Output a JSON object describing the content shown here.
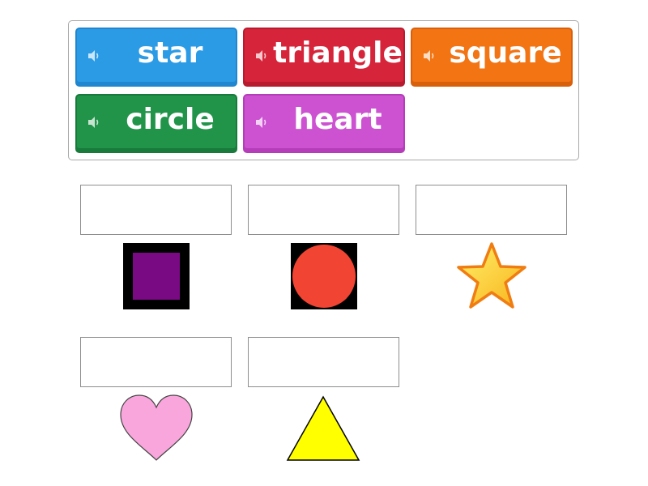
{
  "word_bank": {
    "tiles": [
      {
        "label": "star",
        "color": "#2c9be6",
        "shade": "#1f86cf",
        "icon": "speaker-icon"
      },
      {
        "label": "triangle",
        "color": "#d6243a",
        "shade": "#b91b2e",
        "icon": "speaker-icon"
      },
      {
        "label": "square",
        "color": "#f27413",
        "shade": "#d9600a",
        "icon": "speaker-icon"
      },
      {
        "label": "circle",
        "color": "#21944a",
        "shade": "#187a3b",
        "icon": "speaker-icon"
      },
      {
        "label": "heart",
        "color": "#cc52d1",
        "shade": "#b53db9",
        "icon": "speaker-icon"
      }
    ]
  },
  "targets": [
    {
      "shape": "square",
      "fill": "#7a0a84",
      "background": "#000000"
    },
    {
      "shape": "circle",
      "fill": "#f24432",
      "background": "#000000"
    },
    {
      "shape": "star",
      "fill": "#ffd23c",
      "stroke": "#f07d12"
    },
    {
      "shape": "heart",
      "fill": "#f9a6dc",
      "stroke": "#444444"
    },
    {
      "shape": "triangle",
      "fill": "#ffff00",
      "stroke": "#000000"
    }
  ]
}
